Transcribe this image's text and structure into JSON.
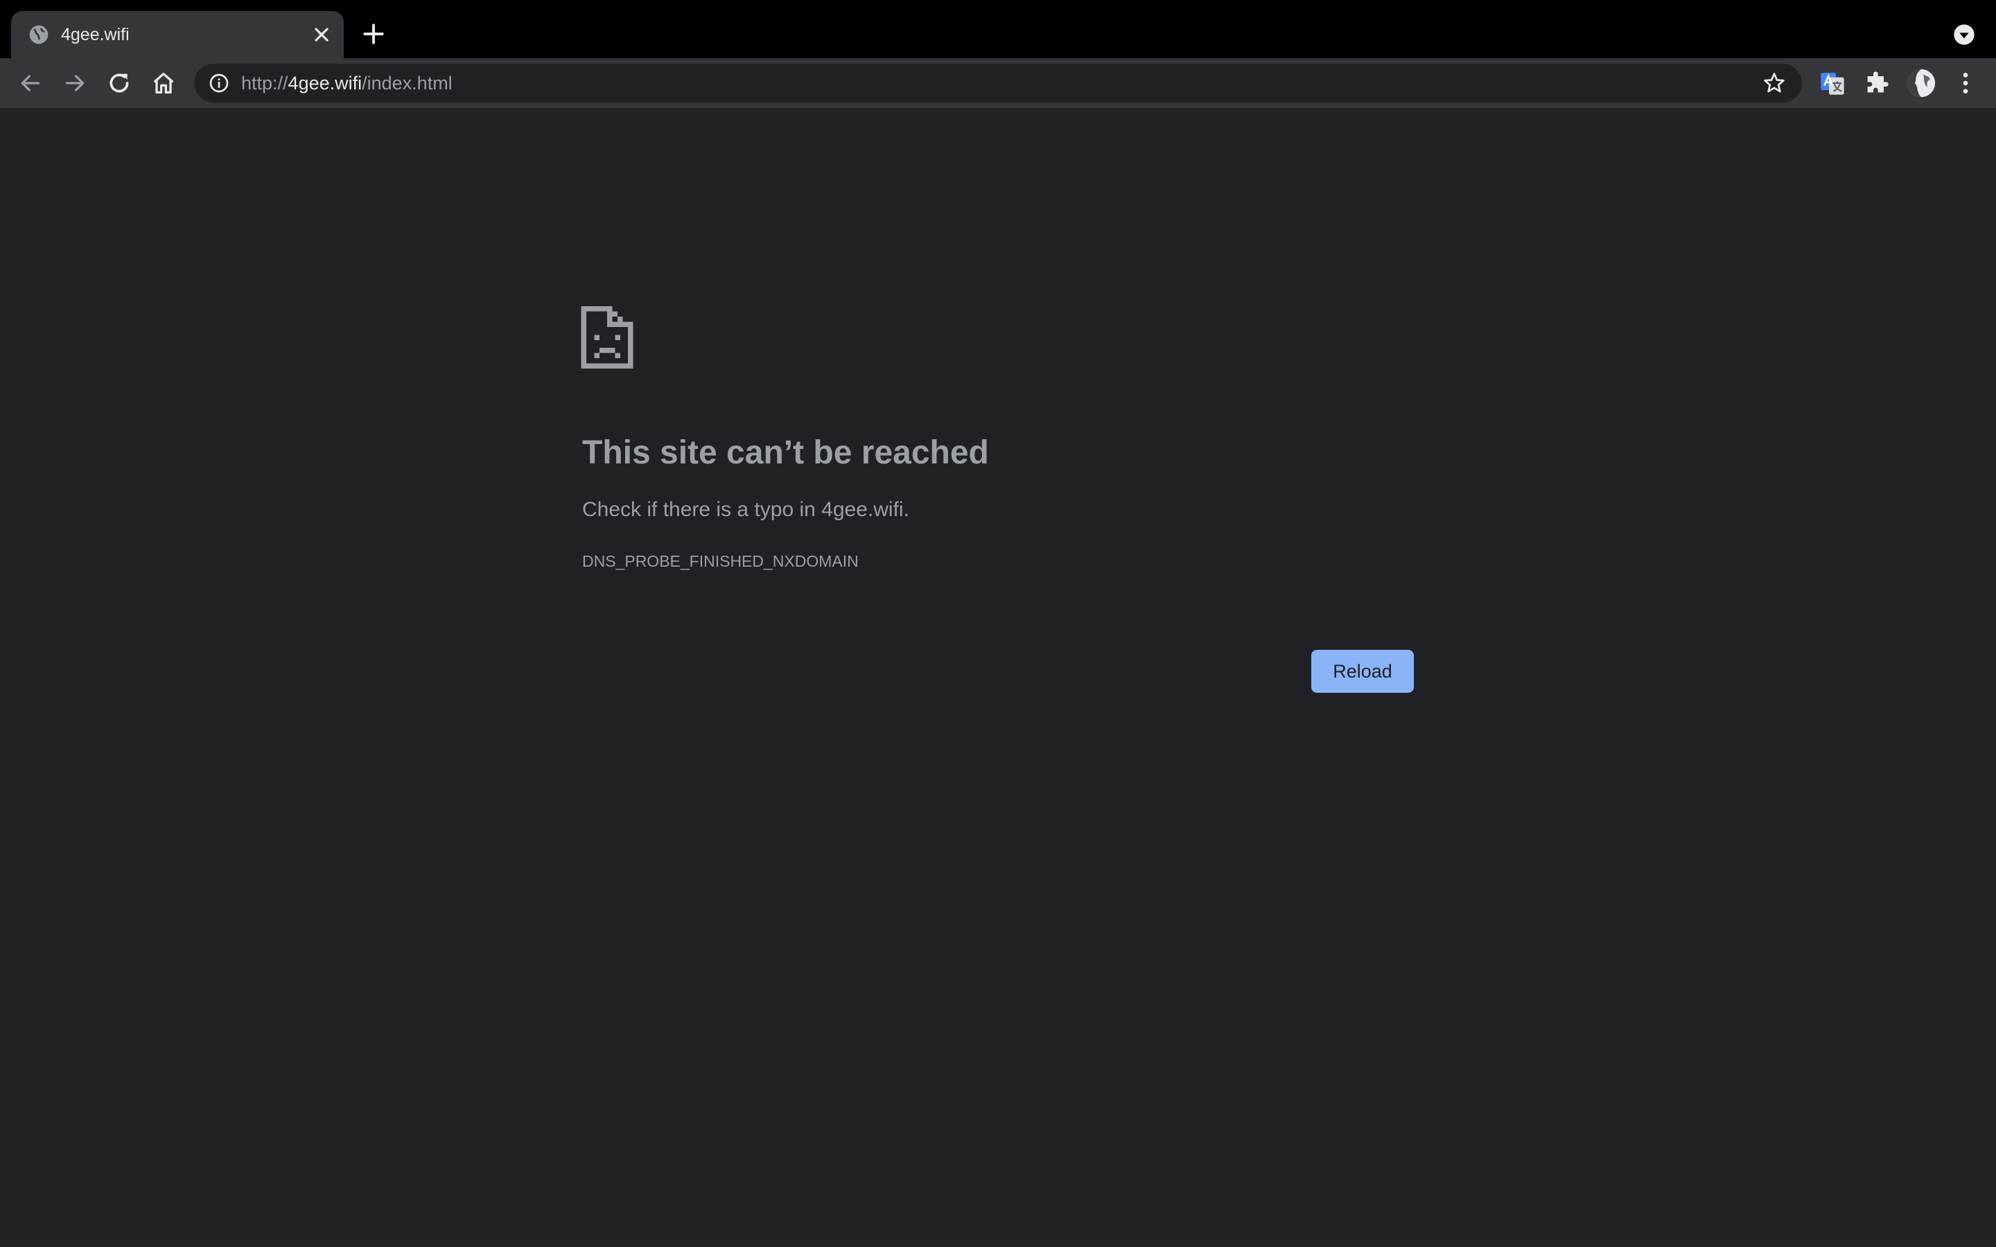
{
  "browser": {
    "tab": {
      "title": "4gee.wifi",
      "favicon": "globe-icon"
    },
    "address_bar": {
      "scheme": "http://",
      "host": "4gee.wifi",
      "path": "/index.html"
    },
    "icons": [
      "back-arrow-icon",
      "forward-arrow-icon",
      "reload-icon",
      "home-icon",
      "info-icon",
      "star-icon",
      "google-translate-icon",
      "puzzle-icon",
      "avatar",
      "kebab-menu-icon",
      "new-tab-icon",
      "tab-search-icon",
      "close-icon"
    ]
  },
  "error_page": {
    "icon": "sad-document-icon",
    "title": "This site can’t be reached",
    "description": "Check if there is a typo in 4gee.wifi.",
    "code": "DNS_PROBE_FINISHED_NXDOMAIN",
    "reload_label": "Reload"
  },
  "colors": {
    "page_background": "#202124",
    "toolbar": "#35363a",
    "tab_strip": "#000000",
    "accent": "#8ab4f8",
    "text_secondary": "#9aa0a6"
  }
}
